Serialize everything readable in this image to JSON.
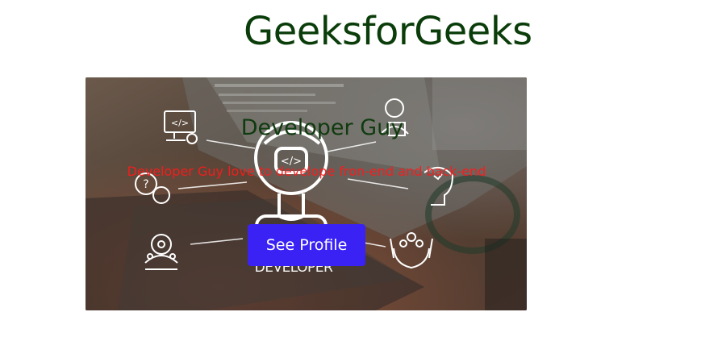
{
  "header": {
    "title": "GeeksforGeeks"
  },
  "card": {
    "image_watermark": "DEVELOPER",
    "heading": "Developer Guy",
    "description": "Developer Guy love to develope fron-end and back-end",
    "button_label": "See Profile"
  },
  "colors": {
    "title": "#0b3d0b",
    "heading": "#0f3b0f",
    "description": "#ff1a1a",
    "button_bg": "#3a22f5",
    "button_text": "#ffffff"
  }
}
